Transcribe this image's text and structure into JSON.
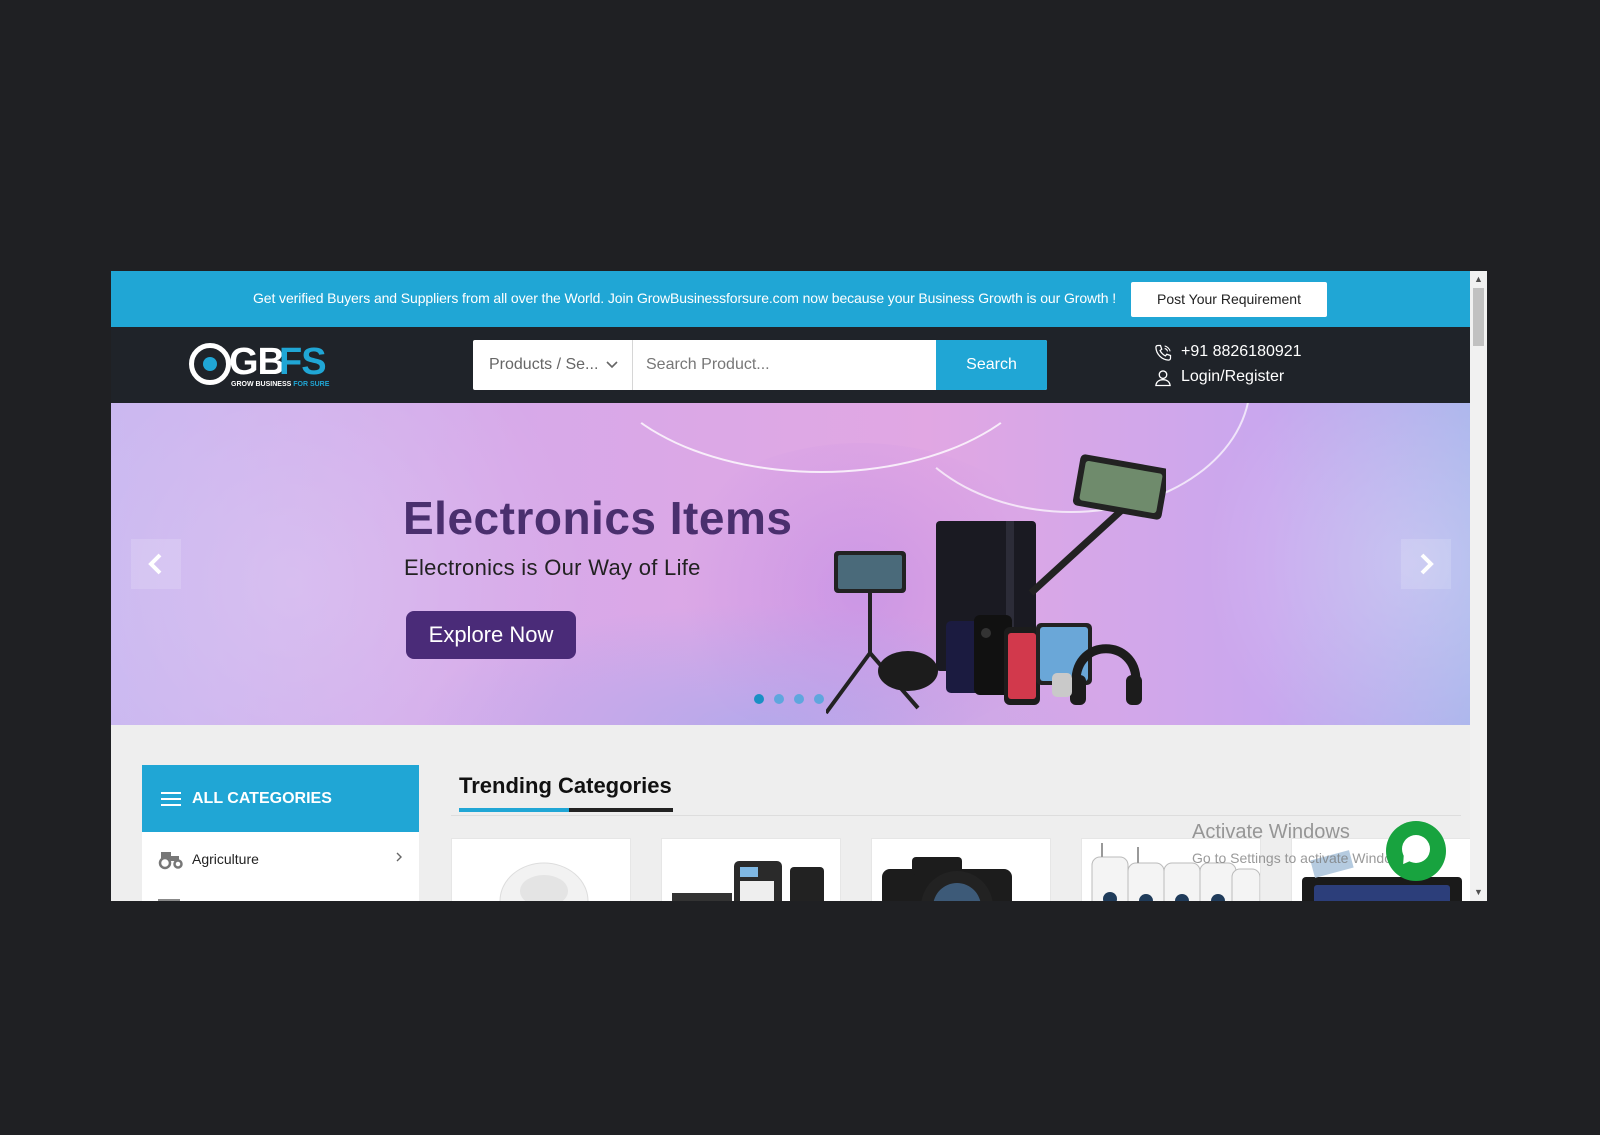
{
  "topbar": {
    "message": "Get verified Buyers and Suppliers from all over the World. Join GrowBusinessforsure.com now because your Business Growth is our Growth !",
    "post_button": "Post Your Requirement"
  },
  "header": {
    "logo": {
      "letters_main": "GB",
      "letters_accent": "FS",
      "tagline_main": "GROW BUSINESS ",
      "tagline_accent": "FOR SURE"
    },
    "search": {
      "category_select": "Products / Se...",
      "placeholder": "Search Product...",
      "button": "Search"
    },
    "contact": {
      "phone": "+91 8826180921",
      "login": "Login/Register"
    }
  },
  "hero": {
    "title": "Electronics Items",
    "subtitle": "Electronics is Our Way of Life",
    "cta": "Explore Now",
    "prev_icon": "chevron-left-icon",
    "next_icon": "chevron-right-icon",
    "slides": 4,
    "active_slide": 1
  },
  "categories": {
    "header": "ALL CATEGORIES",
    "items": [
      {
        "label": "Agriculture",
        "icon": "tractor-icon"
      }
    ]
  },
  "trending": {
    "title": "Trending Categories",
    "cards": [
      "smart-plug",
      "biometric-device",
      "camera",
      "cctv-cameras",
      "car-stereo"
    ]
  },
  "watermark": {
    "line1": "Activate Windows",
    "line2": "Go to Settings to activate Windows."
  },
  "colors": {
    "accent": "#20a6d5",
    "header_bg": "#1f2329",
    "hero_button": "#4a2b78",
    "chat": "#18a33f"
  }
}
